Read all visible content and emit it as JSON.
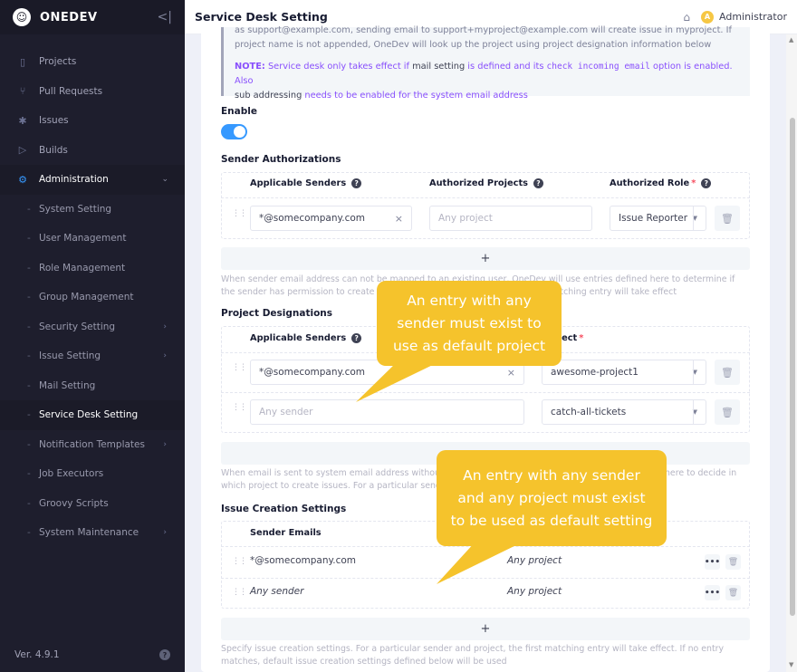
{
  "brand": {
    "name": "ONEDEV"
  },
  "sidebar": {
    "items": [
      {
        "label": "Projects",
        "icon": "projects-icon",
        "glyph": "▯"
      },
      {
        "label": "Pull Requests",
        "icon": "pull-request-icon",
        "glyph": "⑂"
      },
      {
        "label": "Issues",
        "icon": "bug-icon",
        "glyph": "✱"
      },
      {
        "label": "Builds",
        "icon": "play-icon",
        "glyph": "▷"
      },
      {
        "label": "Administration",
        "icon": "gear-icon",
        "glyph": "⚙"
      }
    ],
    "sub_items": [
      {
        "label": "System Setting"
      },
      {
        "label": "User Management"
      },
      {
        "label": "Role Management"
      },
      {
        "label": "Group Management"
      },
      {
        "label": "Security Setting"
      },
      {
        "label": "Issue Setting"
      },
      {
        "label": "Mail Setting"
      },
      {
        "label": "Service Desk Setting"
      },
      {
        "label": "Notification Templates"
      },
      {
        "label": "Job Executors"
      },
      {
        "label": "Groovy Scripts"
      },
      {
        "label": "System Maintenance"
      }
    ],
    "version": "Ver. 4.9.1"
  },
  "topbar": {
    "title": "Service Desk Setting",
    "user": "Administrator",
    "avatar_letter": "A"
  },
  "note": {
    "line1": "as support@example.com, sending email to support+myproject@example.com will create issue in myproject. If",
    "line2": "project name is not appended, OneDev will look up the project using project designation information below",
    "note_label": "NOTE:",
    "note_text1": " Service desk only takes effect if ",
    "note_link1": "mail setting",
    "note_text2": " is defined and its ",
    "note_code": "check incoming email",
    "note_text3": " option is enabled. Also",
    "note_link2": "sub addressing",
    "note_text4": " needs to be enabled for the system email address"
  },
  "enable": {
    "label": "Enable",
    "on": true
  },
  "sender_auth": {
    "label": "Sender Authorizations",
    "col_senders": "Applicable Senders",
    "col_projects": "Authorized Projects",
    "col_role": "Authorized Role",
    "row": {
      "senders": "*@somecompany.com",
      "projects_placeholder": "Any project",
      "role": "Issue Reporter"
    },
    "add": "+",
    "help": "When sender email address can not be mapped to an existing user, OneDev will use entries defined here to determine if the sender has permission to create issues. For a particular sender, the first matching entry will take effect"
  },
  "project_designations": {
    "label": "Project Designations",
    "col_senders": "Applicable Senders",
    "col_project": "Project",
    "rows": [
      {
        "senders": "*@somecompany.com",
        "project": "awesome-project1"
      },
      {
        "senders_placeholder": "Any sender",
        "project": "catch-all-tickets"
      }
    ],
    "help": "When email is sent to system email address without specifying project, OneDev will use entries defined here to decide in which project to create issues. For a particular sender, the first matching entry will take effect"
  },
  "issue_creation": {
    "label": "Issue Creation Settings",
    "col_emails": "Sender Emails",
    "rows": [
      {
        "emails": "*@somecompany.com",
        "project": "Any project"
      },
      {
        "emails": "Any sender",
        "project": "Any project"
      }
    ],
    "add": "+",
    "help": "Specify issue creation settings. For a particular sender and project, the first matching entry will take effect. If no entry matches, default issue creation settings defined below will be used"
  },
  "callouts": {
    "one": [
      "An entry with any",
      "sender must exist to",
      "use as default project"
    ],
    "two": [
      "An entry with any sender",
      "and any project must exist",
      "to be used as default setting"
    ]
  },
  "colors": {
    "accent": "#3699ff",
    "callout": "#f5c32c",
    "sidebar": "#1e1e2d"
  }
}
